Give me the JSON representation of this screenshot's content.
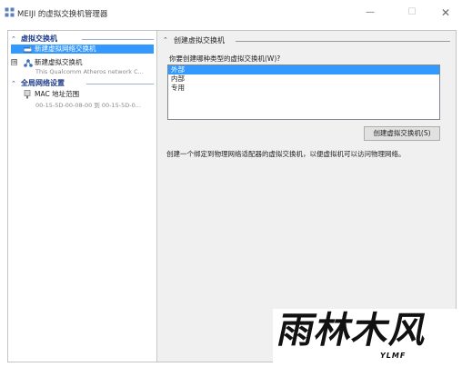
{
  "window": {
    "title": "MEIJI 的虚拟交换机管理器",
    "minimize": "—",
    "maximize": "☐",
    "close": "✕"
  },
  "left_pane": {
    "section_switches": {
      "chevron": "⌃",
      "label": "虚拟交换机"
    },
    "items": [
      {
        "label": "新建虚拟网络交换机",
        "selected": true,
        "icon": "new-switch-icon"
      },
      {
        "label": "新建虚拟交换机",
        "sub": "This Qualcomm Atheros network C...",
        "icon": "network-switch-icon",
        "expander": "⊞"
      }
    ],
    "section_global": {
      "chevron": "⌃",
      "label": "全局网络设置"
    },
    "mac": {
      "label": "MAC 地址范围",
      "sub": "00-15-5D-00-08-00 到 00-15-5D-0...",
      "icon": "network-card-icon"
    }
  },
  "right_pane": {
    "header": {
      "toggle": "⌃",
      "label": "创建虚拟交换机"
    },
    "prompt": "你要创建哪种类型的虚拟交换机(W)?",
    "options": [
      {
        "label": "外部",
        "selected": true
      },
      {
        "label": "内部",
        "selected": false
      },
      {
        "label": "专用",
        "selected": false
      }
    ],
    "create_button": "创建虚拟交换机(S)",
    "description": "创建一个绑定到物理网络适配器的虚拟交换机，以便虚拟机可以访问物理网络。"
  },
  "watermark": {
    "main": "雨林木风",
    "sub": "YLMF"
  },
  "colors": {
    "selection": "#3399ff",
    "section_text": "#1f3d8a",
    "pane_bg": "#f0f0f0"
  }
}
